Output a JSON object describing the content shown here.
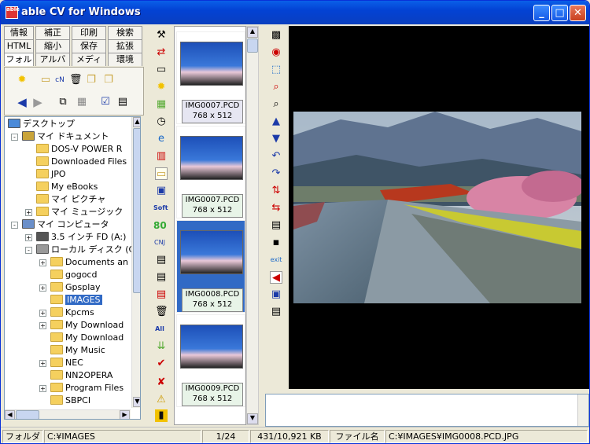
{
  "window": {
    "title": "able CV for Windows",
    "app_icon_text": "able"
  },
  "left_tabs": [
    [
      "情報",
      "補正",
      "印刷",
      "検索"
    ],
    [
      "HTML",
      "縮小",
      "保存",
      "拡張"
    ],
    [
      "フォルダ",
      "アルバム",
      "メディア",
      "環境"
    ]
  ],
  "tree": [
    {
      "label": "デスクトップ",
      "indent": 0,
      "icon": "desktop"
    },
    {
      "label": "マイ ドキュメント",
      "indent": 1,
      "icon": "mydocs",
      "exp": "-"
    },
    {
      "label": "DOS-V POWER R",
      "indent": 2,
      "icon": "folder"
    },
    {
      "label": "Downloaded Files",
      "indent": 2,
      "icon": "folder"
    },
    {
      "label": "JPO",
      "indent": 2,
      "icon": "folder"
    },
    {
      "label": "My eBooks",
      "indent": 2,
      "icon": "folder"
    },
    {
      "label": "マイ ピクチャ",
      "indent": 2,
      "icon": "folder"
    },
    {
      "label": "マイ ミュージック",
      "indent": 2,
      "icon": "folder",
      "exp": "+"
    },
    {
      "label": "マイ コンピュータ",
      "indent": 1,
      "icon": "computer",
      "exp": "-"
    },
    {
      "label": "3.5 インチ FD (A:)",
      "indent": 2,
      "icon": "floppy",
      "exp": "+"
    },
    {
      "label": "ローカル ディスク (C",
      "indent": 2,
      "icon": "disk",
      "exp": "-"
    },
    {
      "label": "Documents an",
      "indent": 3,
      "icon": "folder",
      "exp": "+"
    },
    {
      "label": "gogocd",
      "indent": 3,
      "icon": "folder"
    },
    {
      "label": "Gpsplay",
      "indent": 3,
      "icon": "folder",
      "exp": "+"
    },
    {
      "label": "IMAGES",
      "indent": 3,
      "icon": "folder",
      "selected": true
    },
    {
      "label": "Kpcms",
      "indent": 3,
      "icon": "folder",
      "exp": "+"
    },
    {
      "label": "My Download",
      "indent": 3,
      "icon": "folder",
      "exp": "+"
    },
    {
      "label": "My Download",
      "indent": 3,
      "icon": "folder"
    },
    {
      "label": "My Music",
      "indent": 3,
      "icon": "folder"
    },
    {
      "label": "NEC",
      "indent": 3,
      "icon": "folder",
      "exp": "+"
    },
    {
      "label": "NN2OPERA",
      "indent": 3,
      "icon": "folder"
    },
    {
      "label": "Program Files",
      "indent": 3,
      "icon": "folder",
      "exp": "+"
    },
    {
      "label": "SBPCI",
      "indent": 3,
      "icon": "folder"
    }
  ],
  "thumbnails": [
    {
      "name": "IMG0007.PCD",
      "size": "768 x 512",
      "cap_style": "first"
    },
    {
      "name": "IMG0007.PCD",
      "size": "768 x 512",
      "cap_style": ""
    },
    {
      "name": "IMG0008.PCD",
      "size": "768 x 512",
      "cap_style": "",
      "selected": true
    },
    {
      "name": "IMG0009.PCD",
      "size": "768 x 512",
      "cap_style": ""
    }
  ],
  "mid_tool_labels": {
    "soft": "Soft",
    "eighty": "80",
    "cn": "CNJ",
    "all": "All"
  },
  "status": {
    "folder_label": "フォルダ",
    "folder_path": "C:¥IMAGES",
    "page": "1/24",
    "size": "431/10,921 KB",
    "file_label": "ファイル名",
    "file_path": "C:¥IMAGES¥IMG0008.PCD.JPG"
  },
  "colors": {
    "titlebar": "#0a5fe8",
    "selection": "#316ac5",
    "viewer_bg": "#000000"
  }
}
